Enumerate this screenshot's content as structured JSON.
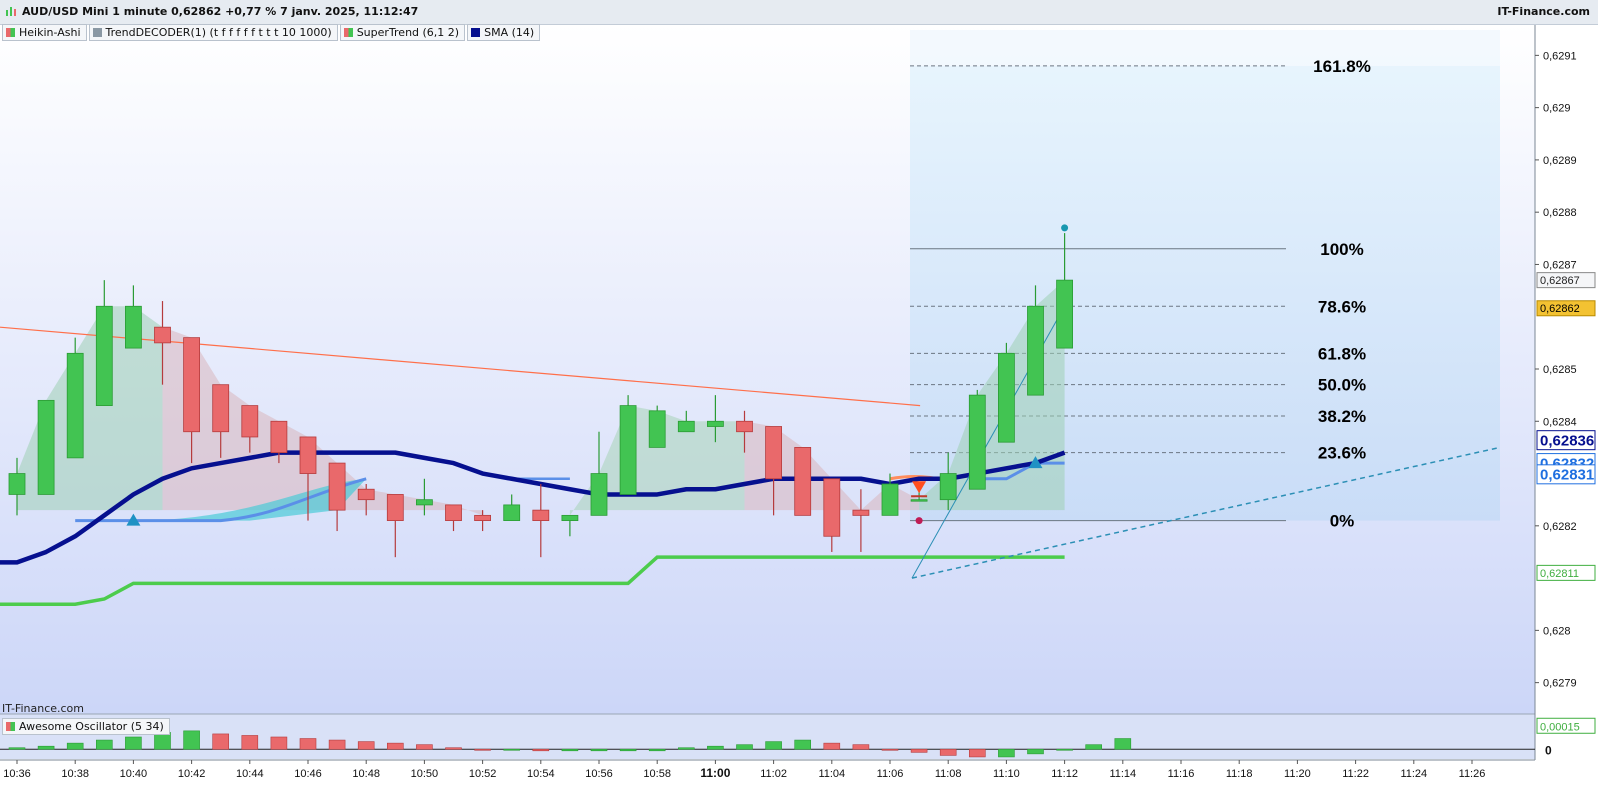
{
  "header": {
    "title": "AUD/USD Mini 1 minute 0,62862 +0,77 % 7 janv. 2025, 11:12:47",
    "brand": "IT-Finance.com"
  },
  "legend": [
    "Heikin-Ashi",
    "TrendDECODER(1) (t f f f f f t t t 10 1000)",
    "SuperTrend (6,1 2)",
    "SMA (14)"
  ],
  "watermark": "IT-Finance.com",
  "oscillator_legend": "Awesome Oscillator (5 34)",
  "colors": {
    "up_candle": "#42c452",
    "down_candle": "#e9696b",
    "sma": "#06108f",
    "supertrend": "#4ccc4c",
    "trendline": "#ff6f4a",
    "fib_zone": "#cfe6f8",
    "trend_blue": "#5b8fe8"
  },
  "chart_data": [
    {
      "type": "candlestick",
      "title": "AUD/USD Mini 1 minute",
      "variant": "Heikin-Ashi",
      "y_axis_ticks": [
        "0,6279",
        "0,628",
        "0,6281",
        "0,6282",
        "0,6283",
        "0,6284",
        "0,6285",
        "0,6286",
        "0,6287",
        "0,6288",
        "0,6289",
        "0,629",
        "0,6291"
      ],
      "y_axis_ticks_display": [
        "0,6279",
        "0,628",
        "",
        "0,6282",
        "",
        "0,6284",
        "0,6285",
        "",
        "0,6287",
        "0,6288",
        "0,6289",
        "0,629",
        "0,6291"
      ],
      "ylim": [
        0.62784,
        0.62916
      ],
      "x_axis_ticks": [
        "10:36",
        "10:38",
        "10:40",
        "10:42",
        "10:44",
        "10:46",
        "10:48",
        "10:50",
        "10:52",
        "10:54",
        "10:56",
        "10:58",
        "11:00",
        "11:02",
        "11:04",
        "11:06",
        "11:08",
        "11:10",
        "11:12",
        "11:14",
        "11:16",
        "11:18",
        "11:20",
        "11:22",
        "11:24",
        "11:26"
      ],
      "x_axis_bold": "11:00",
      "candles": [
        {
          "time": "10:36",
          "open": 0.62826,
          "close": 0.6283,
          "high": 0.62833,
          "low": 0.62822
        },
        {
          "time": "10:37",
          "open": 0.62826,
          "close": 0.62844,
          "high": 0.62844,
          "low": 0.62826
        },
        {
          "time": "10:38",
          "open": 0.62833,
          "close": 0.62853,
          "high": 0.62856,
          "low": 0.62833
        },
        {
          "time": "10:39",
          "open": 0.62843,
          "close": 0.62862,
          "high": 0.62867,
          "low": 0.62843
        },
        {
          "time": "10:40",
          "open": 0.62854,
          "close": 0.62862,
          "high": 0.62866,
          "low": 0.62854
        },
        {
          "time": "10:41",
          "open": 0.62858,
          "close": 0.62855,
          "high": 0.62863,
          "low": 0.62847
        },
        {
          "time": "10:42",
          "open": 0.62856,
          "close": 0.62838,
          "high": 0.62856,
          "low": 0.62832
        },
        {
          "time": "10:43",
          "open": 0.62847,
          "close": 0.62838,
          "high": 0.62847,
          "low": 0.62833
        },
        {
          "time": "10:44",
          "open": 0.62843,
          "close": 0.62837,
          "high": 0.62843,
          "low": 0.62834
        },
        {
          "time": "10:45",
          "open": 0.6284,
          "close": 0.62834,
          "high": 0.6284,
          "low": 0.62832
        },
        {
          "time": "10:46",
          "open": 0.62837,
          "close": 0.6283,
          "high": 0.62837,
          "low": 0.62821
        },
        {
          "time": "10:47",
          "open": 0.62832,
          "close": 0.62823,
          "high": 0.62832,
          "low": 0.62819
        },
        {
          "time": "10:48",
          "open": 0.62827,
          "close": 0.62825,
          "high": 0.62828,
          "low": 0.62822
        },
        {
          "time": "10:49",
          "open": 0.62826,
          "close": 0.62821,
          "high": 0.62826,
          "low": 0.62814
        },
        {
          "time": "10:50",
          "open": 0.62824,
          "close": 0.62825,
          "high": 0.62829,
          "low": 0.62822
        },
        {
          "time": "10:51",
          "open": 0.62824,
          "close": 0.62821,
          "high": 0.62824,
          "low": 0.62819
        },
        {
          "time": "10:52",
          "open": 0.62822,
          "close": 0.62821,
          "high": 0.62823,
          "low": 0.62819
        },
        {
          "time": "10:53",
          "open": 0.62821,
          "close": 0.62824,
          "high": 0.62826,
          "low": 0.62821
        },
        {
          "time": "10:54",
          "open": 0.62823,
          "close": 0.62821,
          "high": 0.62828,
          "low": 0.62814
        },
        {
          "time": "10:55",
          "open": 0.62821,
          "close": 0.62822,
          "high": 0.62822,
          "low": 0.62818
        },
        {
          "time": "10:56",
          "open": 0.62822,
          "close": 0.6283,
          "high": 0.62838,
          "low": 0.62822
        },
        {
          "time": "10:57",
          "open": 0.62826,
          "close": 0.62843,
          "high": 0.62845,
          "low": 0.62826
        },
        {
          "time": "10:58",
          "open": 0.62835,
          "close": 0.62842,
          "high": 0.62843,
          "low": 0.62835
        },
        {
          "time": "10:59",
          "open": 0.62838,
          "close": 0.6284,
          "high": 0.62842,
          "low": 0.62838
        },
        {
          "time": "11:00",
          "open": 0.62839,
          "close": 0.6284,
          "high": 0.62845,
          "low": 0.62836
        },
        {
          "time": "11:01",
          "open": 0.6284,
          "close": 0.62838,
          "high": 0.62842,
          "low": 0.62834
        },
        {
          "time": "11:02",
          "open": 0.62839,
          "close": 0.62829,
          "high": 0.62839,
          "low": 0.62822
        },
        {
          "time": "11:03",
          "open": 0.62835,
          "close": 0.62822,
          "high": 0.62835,
          "low": 0.62822
        },
        {
          "time": "11:04",
          "open": 0.62829,
          "close": 0.62818,
          "high": 0.62829,
          "low": 0.62815
        },
        {
          "time": "11:05",
          "open": 0.62823,
          "close": 0.62822,
          "high": 0.62827,
          "low": 0.62815
        },
        {
          "time": "11:06",
          "open": 0.62822,
          "close": 0.62828,
          "high": 0.6283,
          "low": 0.62822
        },
        {
          "time": "11:07",
          "open": 0.62825,
          "close": 0.62825,
          "high": 0.62827,
          "low": 0.62825
        },
        {
          "time": "11:08",
          "open": 0.62825,
          "close": 0.6283,
          "high": 0.62834,
          "low": 0.62823
        },
        {
          "time": "11:09",
          "open": 0.62827,
          "close": 0.62845,
          "high": 0.62846,
          "low": 0.62827
        },
        {
          "time": "11:10",
          "open": 0.62836,
          "close": 0.62853,
          "high": 0.62855,
          "low": 0.62836
        },
        {
          "time": "11:11",
          "open": 0.62845,
          "close": 0.62862,
          "high": 0.62866,
          "low": 0.62845
        },
        {
          "time": "11:12",
          "open": 0.62854,
          "close": 0.62867,
          "high": 0.62876,
          "low": 0.62854
        }
      ],
      "sma": [
        0.62813,
        0.62815,
        0.62818,
        0.62822,
        0.62826,
        0.62829,
        0.62831,
        0.62832,
        0.62833,
        0.62834,
        0.62834,
        0.62834,
        0.62834,
        0.62834,
        0.62833,
        0.62832,
        0.6283,
        0.62829,
        0.62828,
        0.62827,
        0.62826,
        0.62826,
        0.62826,
        0.62827,
        0.62827,
        0.62828,
        0.62829,
        0.62829,
        0.62829,
        0.62829,
        0.62828,
        0.62829,
        0.62829,
        0.6283,
        0.62831,
        0.62832,
        0.62834
      ],
      "supertrend": [
        {
          "time": "10:36",
          "value": 0.62805
        },
        {
          "time": "10:38",
          "value": 0.62805
        },
        {
          "time": "10:39",
          "value": 0.62806
        },
        {
          "time": "10:40",
          "value": 0.62809
        },
        {
          "time": "10:57",
          "value": 0.62809
        },
        {
          "time": "10:58",
          "value": 0.62814
        },
        {
          "time": "11:12",
          "value": 0.62814
        }
      ],
      "trendline": [
        {
          "time": "10:36",
          "value": 0.62858
        },
        {
          "time": "11:07",
          "value": 0.62843
        }
      ],
      "fibonacci": [
        {
          "label": "161.8%",
          "value": 0.62908
        },
        {
          "label": "100%",
          "value": 0.62873
        },
        {
          "label": "78.6%",
          "value": 0.62862
        },
        {
          "label": "61.8%",
          "value": 0.62853
        },
        {
          "label": "50.0%",
          "value": 0.62847
        },
        {
          "label": "38.2%",
          "value": 0.62841
        },
        {
          "label": "23.6%",
          "value": 0.62834
        },
        {
          "label": "0%",
          "value": 0.62821
        }
      ],
      "price_labels": [
        {
          "value": 0.62867,
          "label": "0,62867",
          "style": "plain"
        },
        {
          "value": 0.62862,
          "label": "0,62862",
          "style": "current"
        },
        {
          "value": 0.62836,
          "label": "0,62836",
          "style": "sma"
        },
        {
          "value": 0.62832,
          "label": "0,62832",
          "style": "blue"
        },
        {
          "value": 0.62831,
          "label": "0,62831",
          "style": "blue"
        },
        {
          "value": 0.62811,
          "label": "0,62811",
          "style": "green"
        }
      ],
      "signals": [
        {
          "time": "10:40",
          "value": 0.62821,
          "type": "up-arrow"
        },
        {
          "time": "11:07",
          "value": 0.62827,
          "type": "down-arrow"
        },
        {
          "time": "11:11",
          "value": 0.62832,
          "type": "up-arrow"
        }
      ]
    },
    {
      "type": "bar",
      "title": "Awesome Oscillator (5 34)",
      "y_axis_ticks": [
        "0,00015",
        "0"
      ],
      "ylim": [
        -7e-05,
        0.00023
      ],
      "values": [
        1e-05,
        2e-05,
        4e-05,
        6e-05,
        8e-05,
        0.00011,
        0.00012,
        0.0001,
        9e-05,
        8e-05,
        7e-05,
        6e-05,
        5e-05,
        4e-05,
        3e-05,
        1e-05,
        0.0,
        0.0,
        -1e-05,
        -1e-05,
        -1e-05,
        -1e-05,
        -1e-05,
        1e-05,
        2e-05,
        3e-05,
        5e-05,
        6e-05,
        4e-05,
        3e-05,
        0.0,
        -2e-05,
        -4e-05,
        -5e-05,
        -5e-05,
        -3e-05,
        0.0,
        3e-05,
        7e-05
      ]
    }
  ]
}
